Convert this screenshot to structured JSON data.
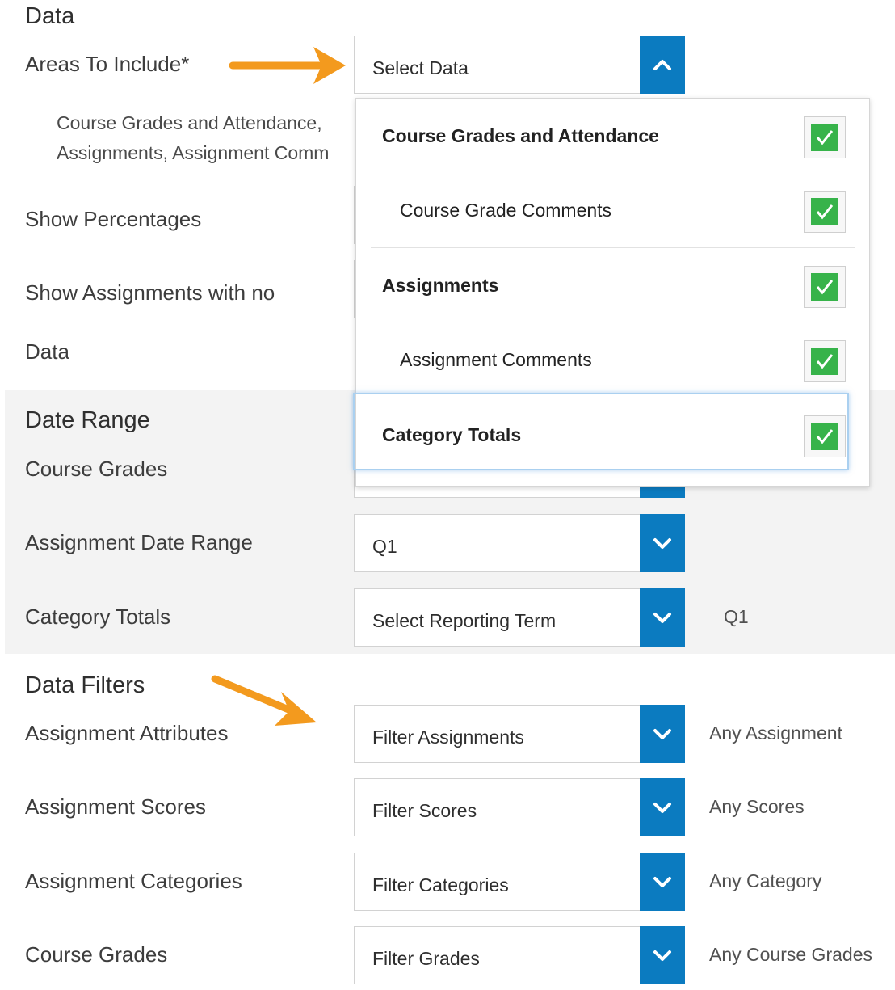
{
  "data_section": {
    "title": "Data",
    "areas_label": "Areas To Include*",
    "areas_select": {
      "value": "Select Data",
      "expanded": true
    },
    "summary_lines": [
      "Course Grades and Attendance,",
      "Assignments, Assignment Comm"
    ],
    "show_percentages_label": "Show Percentages",
    "show_no_data_label": "Show Assignments with no",
    "show_no_data_label_2": "Data",
    "dropdown_items": [
      {
        "label": "Course Grades and Attendance",
        "level": "parent",
        "checked": true
      },
      {
        "label": "Course Grade Comments",
        "level": "child",
        "checked": true
      },
      {
        "label": "Assignments",
        "level": "parent",
        "checked": true
      },
      {
        "label": "Assignment Comments",
        "level": "child",
        "checked": true
      },
      {
        "label": "Category Totals",
        "level": "parent",
        "checked": true,
        "focused": true
      }
    ]
  },
  "date_range": {
    "title": "Date Range",
    "course_grades_label": "Course Grades",
    "assignment_date_range_label": "Assignment Date Range",
    "assignment_date_range_value": "Q1",
    "category_totals_label": "Category Totals",
    "category_totals_value": "Select Reporting Term",
    "category_totals_side": "Q1"
  },
  "filters": {
    "title": "Data Filters",
    "rows": [
      {
        "label": "Assignment Attributes",
        "select": "Filter Assignments",
        "side": "Any Assignment"
      },
      {
        "label": "Assignment Scores",
        "select": "Filter Scores",
        "side": "Any Scores"
      },
      {
        "label": "Assignment Categories",
        "select": "Filter Categories",
        "side": "Any Category"
      },
      {
        "label": "Course Grades",
        "select": "Filter Grades",
        "side": "Any Course Grades"
      }
    ]
  },
  "colors": {
    "accent": "#0b7bc0",
    "check_green": "#37b34a",
    "arrow_orange": "#f39a1e",
    "section_shade": "#f3f3f3"
  }
}
